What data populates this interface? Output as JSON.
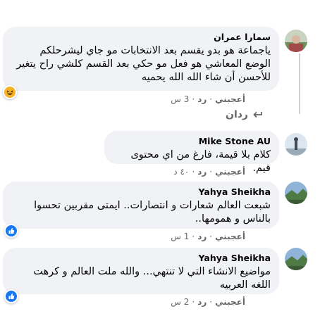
{
  "comments": [
    {
      "author": "سمارا عمران",
      "text": "ياجماعة هو بدو يقسم بعد الانتخابات مو جاي ليشرحلكم الوضع المعاشي هو فعل مو حكي بعد القسم كلشي راح يتغير للأحسن أن شاء الله الله يحميه",
      "like_label": "أعجبني",
      "reply_label": "رد",
      "time": "3 س",
      "reaction": "haha-reaction"
    },
    {
      "author": "Mike Stone AU",
      "text": "كلام بلا قيمة، فارغ من اي محتوى قيم.",
      "like_label": "أعجبني",
      "reply_label": "رد",
      "time": "٤٠ د"
    },
    {
      "author": "Yahya Sheikha",
      "text": "شبعت العالم شعارات و انتصارات.. ايمتى مقربين تحسوا بالناس و همومها..",
      "like_label": "أعجبني",
      "reply_label": "رد",
      "time": "1 س",
      "reaction": "like-reaction"
    },
    {
      "author": "Yahya Sheikha",
      "text": "مواضيع الانشاء التي لا تنتهي... والله ملت العالم و كرهت اللغه العربيه",
      "like_label": "أعجبني",
      "reply_label": "رد",
      "time": "2 س",
      "reaction": "like-reaction"
    }
  ],
  "replies_link": "ردان",
  "colors": {
    "bubble": "#f0f2f5",
    "meta": "#65676b",
    "like_blue": "#1877f2",
    "haha_yellow": "#f7b125"
  }
}
